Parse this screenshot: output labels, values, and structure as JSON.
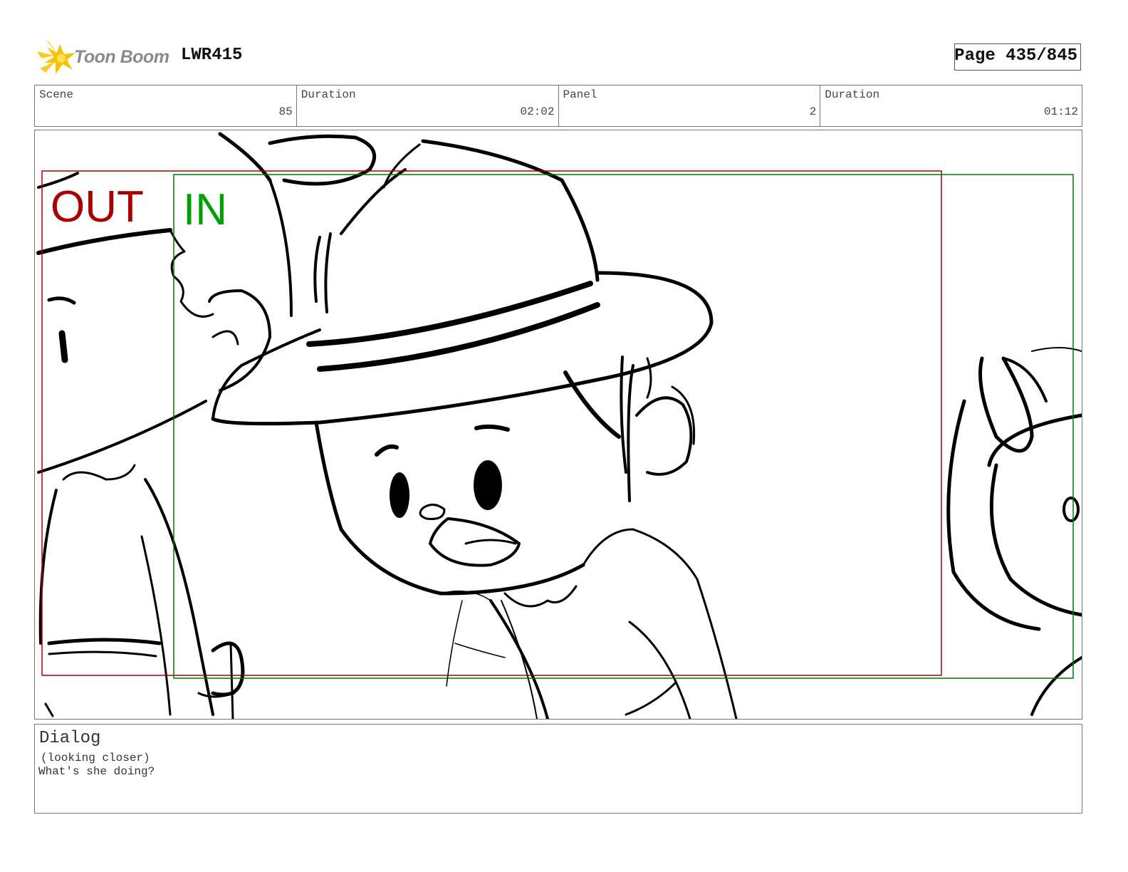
{
  "header": {
    "logo_text": "Toon Boom",
    "project": "LWR415",
    "page": "Page 435/845"
  },
  "info": {
    "scene_label": "Scene",
    "scene_value": "85",
    "scene_duration_label": "Duration",
    "scene_duration_value": "02:02",
    "panel_label": "Panel",
    "panel_value": "2",
    "panel_duration_label": "Duration",
    "panel_duration_value": "01:12"
  },
  "frame": {
    "out_label": "OUT",
    "in_label": "IN",
    "out_color": "#a80000",
    "in_color": "#00a000"
  },
  "dialog": {
    "title": "Dialog",
    "line1": "(looking closer)",
    "line2": "What's she doing?"
  },
  "logo_icon": "starburst-icon",
  "logo_color": "#f5c400"
}
